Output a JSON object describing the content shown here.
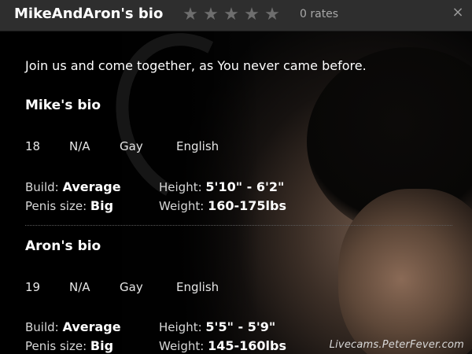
{
  "header": {
    "title": "MikeAndAron's bio",
    "stars": [
      "★",
      "★",
      "★",
      "★",
      "★"
    ],
    "rates": "0 rates",
    "close_icon": "×"
  },
  "tagline": "Join us and come together, as You never came before.",
  "bios": [
    {
      "title": "Mike's bio",
      "age": "18",
      "location": "N/A",
      "orientation": "Gay",
      "language": "English",
      "build_label": "Build:",
      "build": "Average",
      "penis_label": "Penis size:",
      "penis": "Big",
      "height_label": "Height:",
      "height": "5'10\" - 6'2\"",
      "weight_label": "Weight:",
      "weight": "160-175lbs"
    },
    {
      "title": "Aron's bio",
      "age": "19",
      "location": "N/A",
      "orientation": "Gay",
      "language": "English",
      "build_label": "Build:",
      "build": "Average",
      "penis_label": "Penis size:",
      "penis": "Big",
      "height_label": "Height:",
      "height": "5'5\" - 5'9\"",
      "weight_label": "Weight:",
      "weight": "145-160lbs"
    }
  ],
  "watermark": "Livecams.PeterFever.com",
  "colors": {
    "header_bg": "#2e2e2e",
    "star": "#6e6e6e",
    "rates": "#a8a8a8"
  }
}
